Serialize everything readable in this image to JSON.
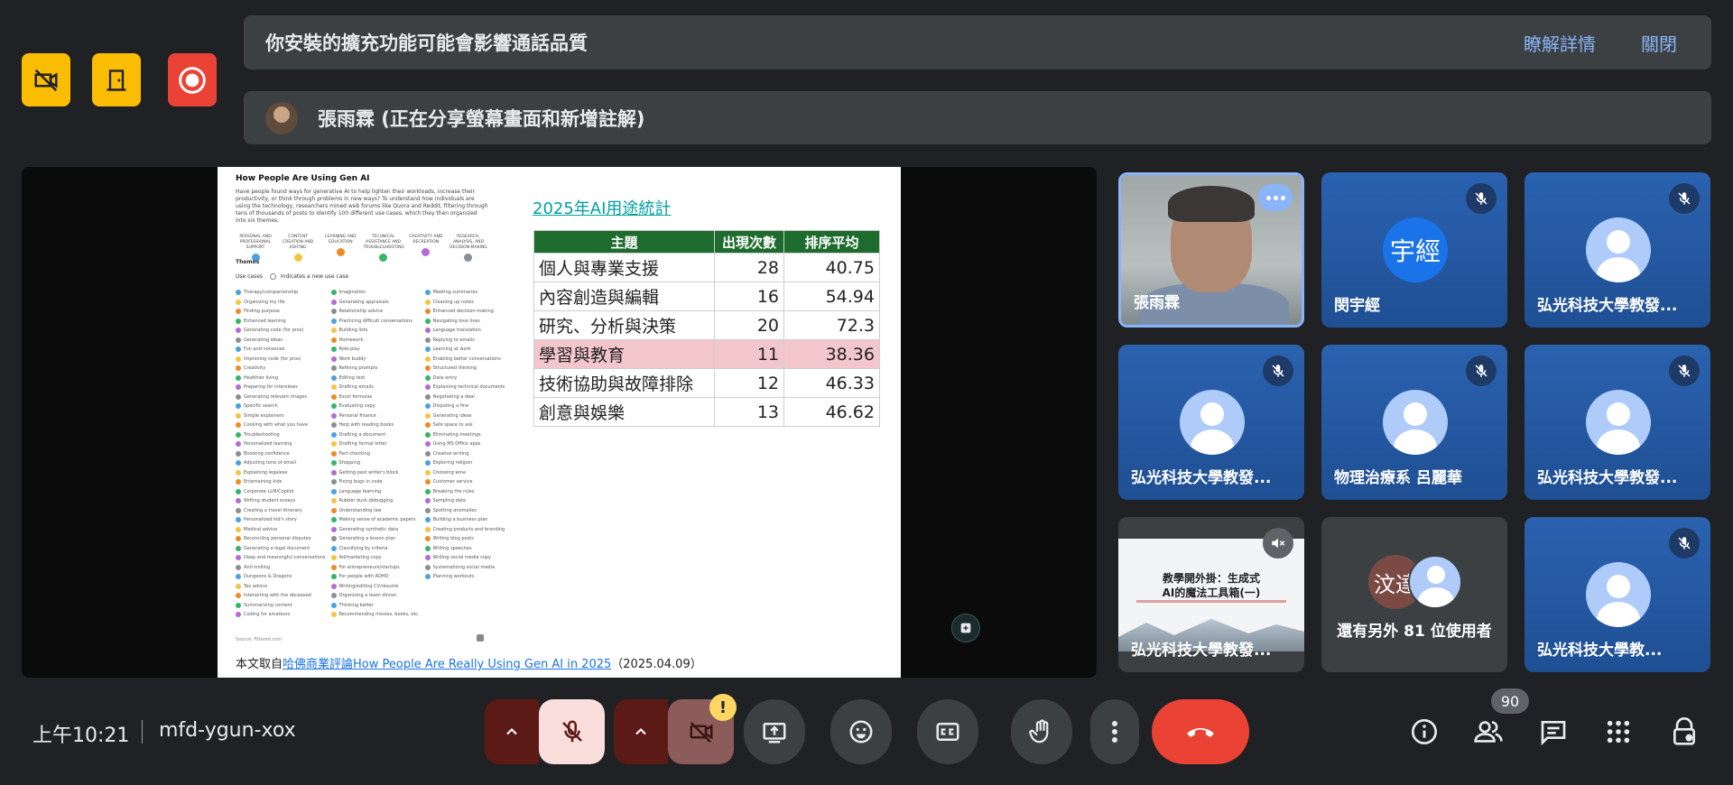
{
  "host_controls": [
    {
      "icon": "video-off-icon",
      "color": "#fbbc04"
    },
    {
      "icon": "door-exit-icon",
      "color": "#fbbc04"
    },
    {
      "icon": "record-icon",
      "color": "#ea4335"
    }
  ],
  "notice": {
    "text": "你安裝的擴充功能可能會影響通話品質",
    "learn_more": "瞭解詳情",
    "close": "關閉"
  },
  "presenter_banner": {
    "text": "張雨霖 (正在分享螢幕畫面和新增註解)"
  },
  "slide": {
    "left_title": "How People Are Using Gen AI",
    "left_desc": "Have people found ways for generative AI to help lighten their workloads, increase their productivity, or think through problems in new ways? To understand how individuals are using the technology, researchers mined web forums like Quora and Reddit, filtering through tens of thousands of posts to identify 100 different use cases, which they then organized into six themes.",
    "themes": [
      {
        "label": "PERSONAL AND PROFESSIONAL SUPPORT",
        "color": "#4aa3df"
      },
      {
        "label": "CONTENT CREATION AND EDITING",
        "color": "#f4c542"
      },
      {
        "label": "LEARNING AND EDUCATION",
        "color": "#f08a24"
      },
      {
        "label": "TECHNICAL ASSISTANCE AND TROUBLESHOOTING",
        "color": "#35b56a"
      },
      {
        "label": "CREATIVITY AND RECREATION",
        "color": "#b56ad6"
      },
      {
        "label": "RESEARCH, ANALYSIS, AND DECISION-MAKING",
        "color": "#8a8f95"
      }
    ],
    "themes_label": "Themes",
    "use_cases_label": "Use cases",
    "new_use_case_label": "Indicates a new use case",
    "use_cases": [
      [
        "Therapy/companionship",
        "Organizing my life",
        "Finding purpose",
        "Enhanced learning",
        "Generating code (for pros)",
        "Generating ideas",
        "Fun and nonsense",
        "Improving code (for pros)",
        "Creativity",
        "Healthier living",
        "Preparing for interviews",
        "Generating relevant images",
        "Specific search",
        "Simple explainers",
        "Cooking with what you have",
        "Troubleshooting",
        "Personalized learning",
        "Boosting confidence",
        "Adjusting tone of email",
        "Explaining legalese",
        "Entertaining kids",
        "Corporate LLM/Copilot",
        "Writing student essays",
        "Creating a travel itinerary",
        "Personalized kid's story",
        "Medical advice",
        "Reconciling personal disputes",
        "Generating a legal document",
        "Deep and meaningful conversations",
        "Anti-trolling",
        "Dungeons & Dragons",
        "Tax advice",
        "Interacting with the deceased",
        "Summarizing content",
        "Coding for amateurs"
      ],
      [
        "Imagination",
        "Generating appraisals",
        "Relationship advice",
        "Practicing difficult conversations",
        "Building lists",
        "Homework",
        "Role-play",
        "Work buddy",
        "Refining prompts",
        "Editing text",
        "Drafting emails",
        "Excel formulas",
        "Evaluating copy",
        "Personal finance",
        "Help with reading books",
        "Drafting a document",
        "Drafting formal letter",
        "Fact-checking",
        "Shopping",
        "Getting past writer's block",
        "Fixing bugs in code",
        "Language learning",
        "Rubber duck debugging",
        "Understanding law",
        "Making sense of academic papers",
        "Generating synthetic data",
        "Generating a lesson plan",
        "Classifying by criteria",
        "Ad/marketing copy",
        "For entrepreneurs/startups",
        "For people with ADHD",
        "Writing/editing CV/résumé",
        "Organizing a team dinner",
        "Thinking better",
        "Recommending movies, books, etc."
      ],
      [
        "Meeting summaries",
        "Cleaning up notes",
        "Enhanced decision-making",
        "Navigating love lives",
        "Language translation",
        "Replying to emails",
        "Learning at work",
        "Enabling better conversations",
        "Structured thinking",
        "Data entry",
        "Explaining technical documents",
        "Negotiating a deal",
        "Disputing a fine",
        "Generating ideas",
        "Safe space to ask",
        "Eliminating meetings",
        "Using MS Office apps",
        "Creative writing",
        "Exploring religion",
        "Choosing wine",
        "Customer service",
        "Breaking the rules",
        "Sampling data",
        "Spotting anomalies",
        "Building a business plan",
        "Creating products and branding",
        "Writing blog posts",
        "Writing speeches",
        "Writing social media copy",
        "Systematizing social media",
        "Planning workouts"
      ]
    ],
    "use_case_colors": [
      "#4aa3df",
      "#f4c542",
      "#f08a24",
      "#35b56a",
      "#b56ad6",
      "#8a8f95"
    ],
    "source_footnote": "Source: Filtered.com",
    "source_prefix": "本文取自",
    "source_link": "哈佛商業評論How People Are Really Using Gen AI in 2025",
    "source_date": "（2025.04.09）",
    "table_title": "2025年AI用途統計",
    "table_headers": [
      "主題",
      "出現次數",
      "排序平均"
    ],
    "table_rows": [
      {
        "topic": "個人與專業支援",
        "count": "28",
        "avg": "40.75",
        "highlight": false
      },
      {
        "topic": "內容創造與編輯",
        "count": "16",
        "avg": "54.94",
        "highlight": false
      },
      {
        "topic": "研究、分析與決策",
        "count": "20",
        "avg": "72.3",
        "highlight": false
      },
      {
        "topic": "學習與教育",
        "count": "11",
        "avg": "38.36",
        "highlight": true
      },
      {
        "topic": "技術協助與故障排除",
        "count": "12",
        "avg": "46.33",
        "highlight": false
      },
      {
        "topic": "創意與娛樂",
        "count": "13",
        "avg": "46.62",
        "highlight": false
      }
    ]
  },
  "participants": {
    "p1": {
      "name": "張雨霖"
    },
    "p2": {
      "name": "閔宇經",
      "initials": "宇經"
    },
    "p3": {
      "name": "弘光科技大學教發..."
    },
    "p4": {
      "name": "弘光科技大學教發..."
    },
    "p5": {
      "name": "物理治療系 呂麗華"
    },
    "p6": {
      "name": "弘光科技大學教發..."
    },
    "p7": {
      "name": "弘光科技大學教發...",
      "slide_line1": "教學開外掛：生成式",
      "slide_line2": "AI的魔法工具箱(一)"
    },
    "p8": {
      "text": "還有另外 81 位使用者",
      "initials": "汶達"
    },
    "p9": {
      "name": "弘光科技大學教..."
    }
  },
  "bottom": {
    "time": "上午10:21",
    "meeting_code": "mfd-ygun-xox",
    "warn": "!",
    "participant_count": "90"
  }
}
